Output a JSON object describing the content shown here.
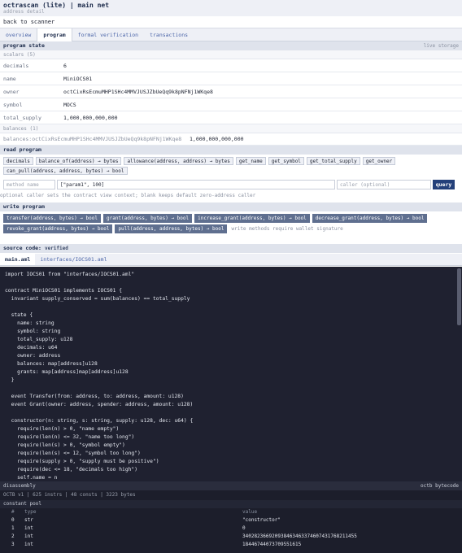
{
  "header": {
    "title": "octrascan (lite) | main net",
    "subtitle": "address detail"
  },
  "back_link": "back to scanner",
  "tabs": [
    "overview",
    "program",
    "formal verification",
    "transactions"
  ],
  "active_tab": "program",
  "program_state": {
    "title": "program state",
    "right_label": "live storage",
    "scalars_label": "scalars (5)",
    "scalars": [
      {
        "key": "decimals",
        "value": "6"
      },
      {
        "key": "name",
        "value": "MiniOCS01"
      },
      {
        "key": "owner",
        "value": "octCixRsEcmuMHP1SHc4MMVJUSJZbUeQq9k8pNFNj1WKqe8"
      },
      {
        "key": "symbol",
        "value": "MOCS"
      },
      {
        "key": "total_supply",
        "value": "1,000,000,000,000"
      }
    ],
    "balances_label": "balances (1)",
    "balances": [
      {
        "key": "balances:octCixRsEcmuMHP1SHc4MMVJUSJZbUeQq9k8pNFNj1WKqe8",
        "value": "1,000,000,000,000"
      }
    ]
  },
  "read_program": {
    "title": "read program",
    "methods": [
      "decimals",
      "balance_of(address) → bytes",
      "allowance(address, address) → bytes",
      "get_name",
      "get_symbol",
      "get_total_supply",
      "get_owner",
      "can_pull(address, address, bytes) → bool"
    ],
    "method_placeholder": "method name",
    "params_value": "[\"param1\", 100]",
    "caller_placeholder": "caller (optional)",
    "query_label": "query",
    "hint": "optional caller sets the contract view context; blank keeps default zero-address caller"
  },
  "write_program": {
    "title": "write program",
    "methods": [
      "transfer(address, bytes) → bool",
      "grant(address, bytes) → bool",
      "increase_grant(address, bytes) → bool",
      "decrease_grant(address, bytes) → bool",
      "revoke_grant(address, bytes) → bool",
      "pull(address, address, bytes) → bool"
    ],
    "note": "write methods require wallet signature"
  },
  "source": {
    "title": "source code:",
    "status": "verified",
    "files": [
      "main.aml",
      "interfaces/IOCS01.aml"
    ],
    "code": "import IOCS01 from \"interfaces/IOCS01.aml\"\n\ncontract MiniOCS01 implements IOCS01 {\n  invariant supply_conserved = sum(balances) == total_supply\n\n  state {\n    name: string\n    symbol: string\n    total_supply: u128\n    decimals: u64\n    owner: address\n    balances: map[address]u128\n    grants: map[address]map[address]u128\n  }\n\n  event Transfer(from: address, to: address, amount: u128)\n  event Grant(owner: address, spender: address, amount: u128)\n\n  constructor(n: string, s: string, supply: u128, dec: u64) {\n    require(len(n) > 0, \"name empty\")\n    require(len(n) <= 32, \"name too long\")\n    require(len(s) > 0, \"symbol empty\")\n    require(len(s) <= 12, \"symbol too long\")\n    require(supply > 0, \"supply must be positive\")\n    require(dec <= 18, \"decimals too high\")\n    self.name = n"
  },
  "disassembly": {
    "title": "disassembly",
    "right_label": "octb bytecode",
    "meta": "OCTB v1 | 625 instrs | 48 consts | 3223 bytes",
    "pool_title": "constant pool",
    "columns": [
      "#",
      "type",
      "value"
    ],
    "rows": [
      {
        "idx": "0",
        "type": "str",
        "value": "\"constructor\""
      },
      {
        "idx": "1",
        "type": "int",
        "value": "0"
      },
      {
        "idx": "2",
        "type": "int",
        "value": "340282366920938463463374607431768211455"
      },
      {
        "idx": "3",
        "type": "int",
        "value": "18446744073709551615"
      }
    ]
  }
}
